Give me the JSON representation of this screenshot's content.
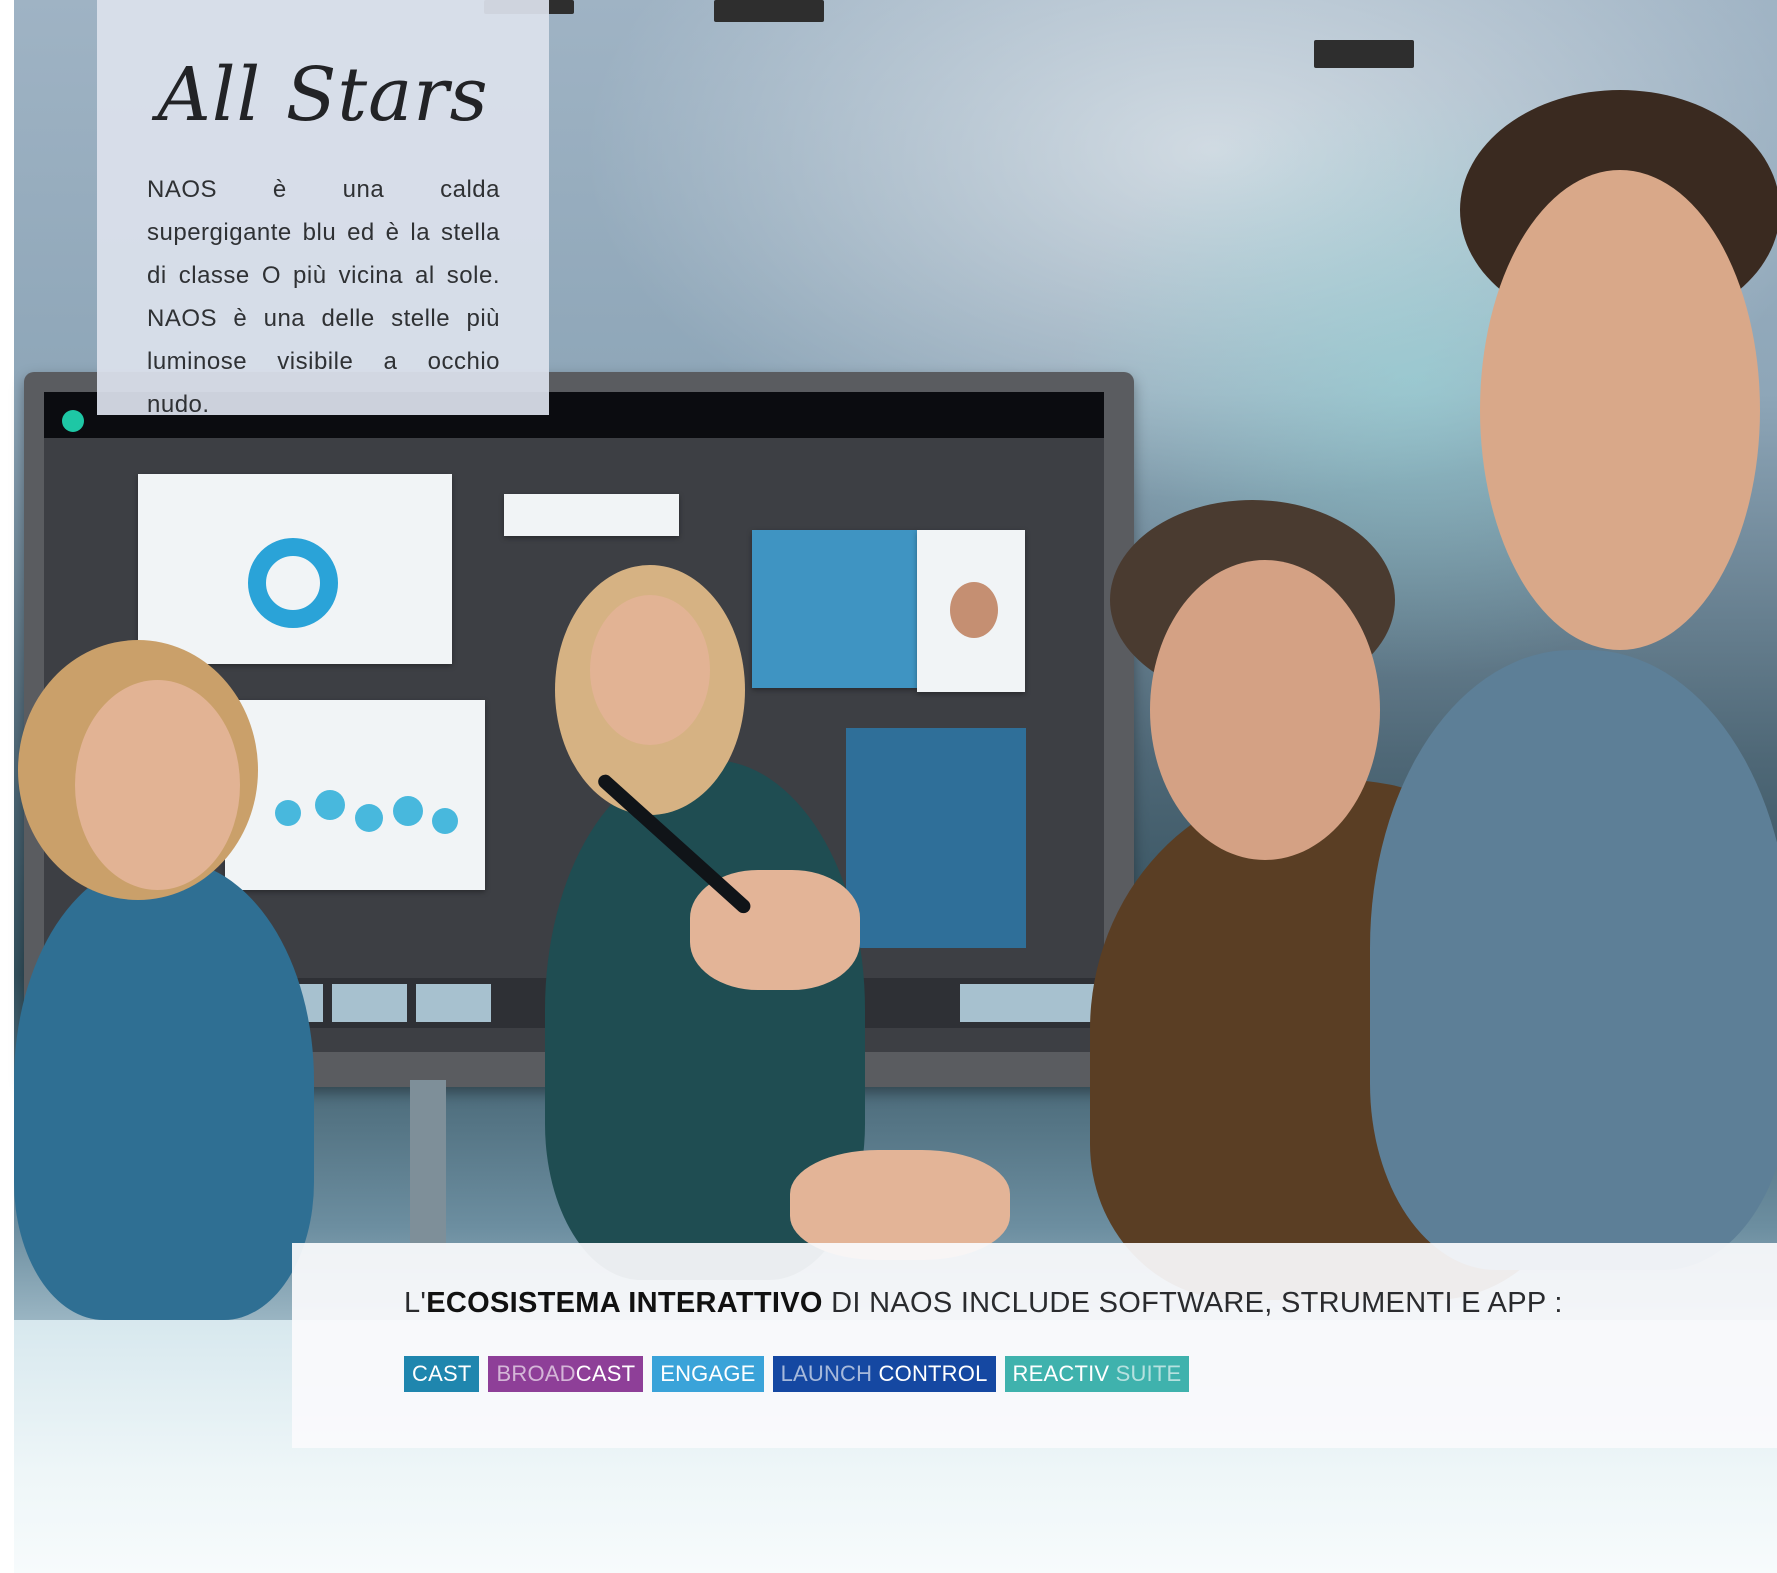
{
  "intro_card": {
    "title": "All Stars",
    "text": "NAOS è una calda supergigante blu ed è la stella di classe O più vicina al sole. NAOS è una delle stelle più luminose visibile a occhio nudo."
  },
  "banner": {
    "prefix": "L'",
    "bold": "ECOSISTEMA INTERATTIVO",
    "rest": " DI NAOS INCLUDE SOFTWARE, STRUMENTI E APP :",
    "tags": [
      {
        "part1": "CAST",
        "part2": "",
        "color": "#1f86ae"
      },
      {
        "part1": "BROAD",
        "part2": "CAST",
        "color": "#8e3f98"
      },
      {
        "part1": "ENGAGE",
        "part2": "",
        "color": "#3aa3d9"
      },
      {
        "part1": "LAUNCH ",
        "part2": "CONTROL",
        "color": "#1548a2"
      },
      {
        "part1": "REACTIV ",
        "part2": "SUITE",
        "color": "#3fb2ad"
      }
    ]
  }
}
